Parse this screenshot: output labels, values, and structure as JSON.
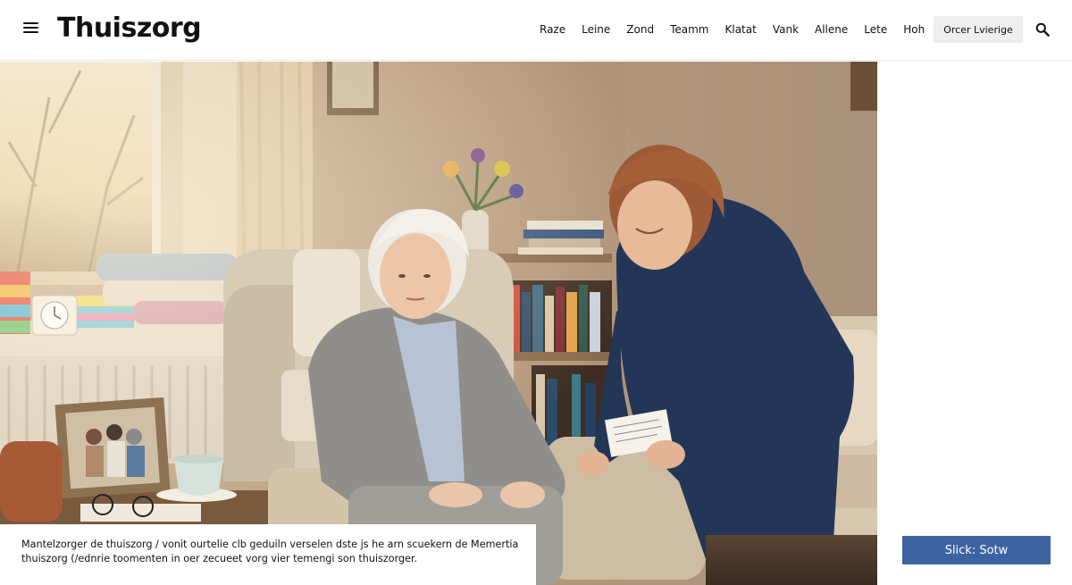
{
  "header": {
    "logo": "Thuiszorg",
    "nav": [
      "Raze",
      "Leine",
      "Zond",
      "Teamm",
      "Klatat",
      "Vank",
      "Allene",
      "Lete",
      "Hoh"
    ],
    "order_button": "Orcer Lvierige",
    "menu_icon": "menu-icon",
    "search_icon": "search-icon"
  },
  "hero": {
    "image": "caregiver-visiting-elderly-woman-photo"
  },
  "caption": {
    "line1": "Mantelzorger de thuiszorg / vonit ourtelie clb geduiln verselen dste js he arn scuekern de Memertia",
    "line2": "thuiszorg (/ednrie toomenten in oer zecueet vorg vier temengi son thuiszorger."
  },
  "cta": {
    "label": "Slick: Sotw"
  },
  "colors": {
    "accent": "#3d63a2",
    "header_bg": "#ffffff",
    "button_bg": "#eeeeee"
  }
}
